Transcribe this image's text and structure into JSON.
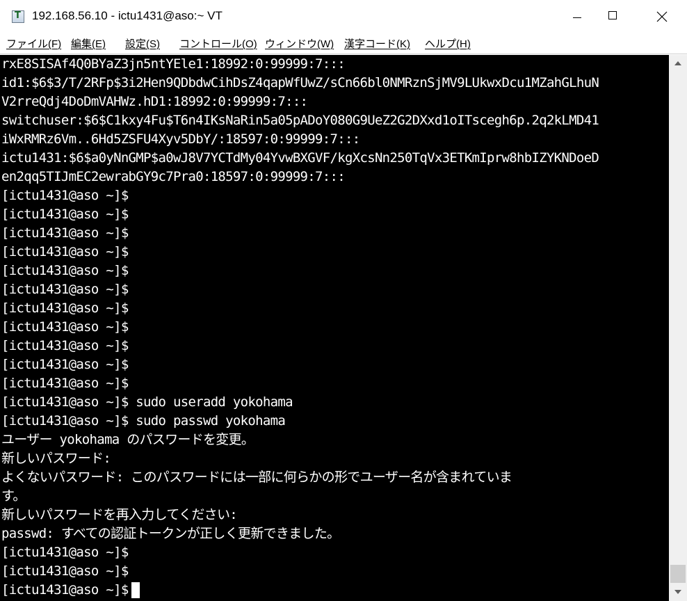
{
  "window": {
    "title": "192.168.56.10 - ictu1431@aso:~ VT",
    "app_icon_letter": "T"
  },
  "menu": [
    "ファイル(F)",
    "編集(E)",
    "設定(S)",
    "コントロール(O)",
    "ウィンドウ(W)",
    "漢字コード(K)",
    "ヘルプ(H)"
  ],
  "terminal": {
    "lines": [
      "rxE8SISAf4Q0BYaZ3jn5ntYEle1:18992:0:99999:7:::",
      "id1:$6$3/T/2RFp$3i2Hen9QDbdwCihDsZ4qapWfUwZ/sCn66bl0NMRznSjMV9LUkwxDcu1MZahGLhuN",
      "V2rreQdj4DoDmVAHWz.hD1:18992:0:99999:7:::",
      "switchuser:$6$C1kxy4Fu$T6n4IKsNaRin5a05pADoY080G9UeZ2G2DXxd1oITscegh6p.2q2kLMD41",
      "iWxRMRz6Vm..6Hd5ZSFU4Xyv5DbY/:18597:0:99999:7:::",
      "ictu1431:$6$a0yNnGMP$a0wJ8V7YCTdMy04YvwBXGVF/kgXcsNn250TqVx3ETKmIprw8hbIZYKNDoeD",
      "en2qq5TIJmEC2ewrabGY9c7Pra0:18597:0:99999:7:::",
      "[ictu1431@aso ~]$",
      "[ictu1431@aso ~]$",
      "[ictu1431@aso ~]$",
      "[ictu1431@aso ~]$",
      "[ictu1431@aso ~]$",
      "[ictu1431@aso ~]$",
      "[ictu1431@aso ~]$",
      "[ictu1431@aso ~]$",
      "[ictu1431@aso ~]$",
      "[ictu1431@aso ~]$",
      "[ictu1431@aso ~]$",
      "[ictu1431@aso ~]$ sudo useradd yokohama",
      "[ictu1431@aso ~]$ sudo passwd yokohama",
      "ユーザー yokohama のパスワードを変更。",
      "新しいパスワード:",
      "よくないパスワード: このパスワードには一部に何らかの形でユーザー名が含まれていま",
      "す。",
      "新しいパスワードを再入力してください:",
      "passwd: すべての認証トークンが正しく更新できました。",
      "[ictu1431@aso ~]$",
      "[ictu1431@aso ~]$",
      "[ictu1431@aso ~]$"
    ]
  }
}
